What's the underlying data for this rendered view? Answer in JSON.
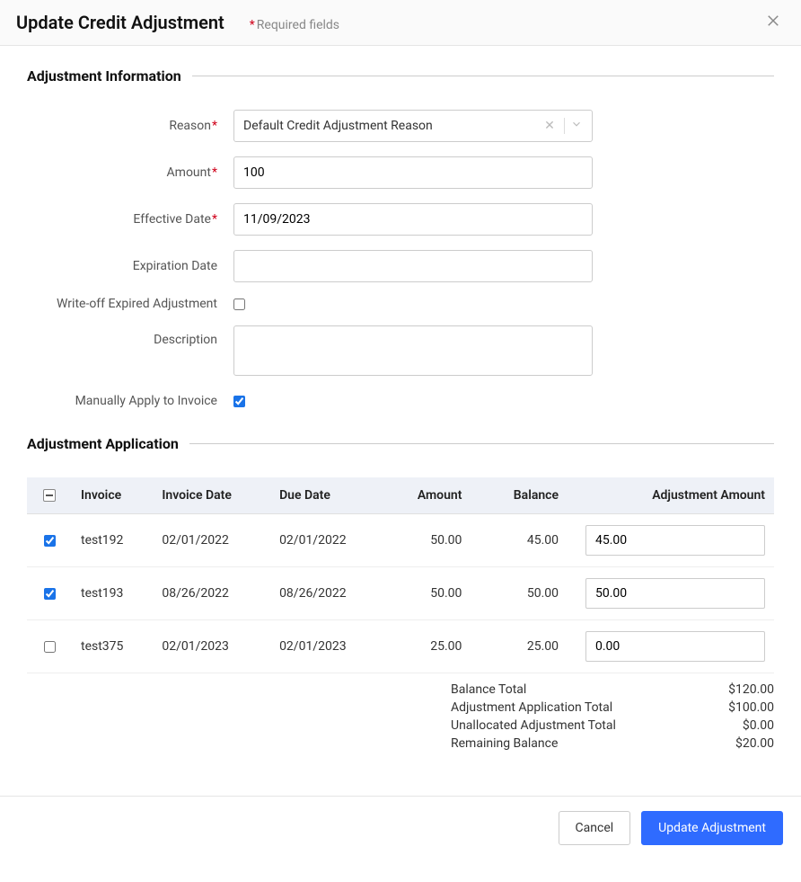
{
  "header": {
    "title": "Update Credit Adjustment",
    "required_note": "Required fields"
  },
  "sections": {
    "adjustment_info_title": "Adjustment Information",
    "adjustment_app_title": "Adjustment Application"
  },
  "form": {
    "labels": {
      "reason": "Reason",
      "amount": "Amount",
      "effective_date": "Effective Date",
      "expiration_date": "Expiration Date",
      "writeoff": "Write-off Expired Adjustment",
      "description": "Description",
      "manual_apply": "Manually Apply to Invoice"
    },
    "values": {
      "reason": "Default Credit Adjustment Reason",
      "amount": "100",
      "effective_date": "11/09/2023",
      "expiration_date": "",
      "writeoff_checked": false,
      "description": "",
      "manual_apply_checked": true
    }
  },
  "table": {
    "headers": {
      "invoice": "Invoice",
      "invoice_date": "Invoice Date",
      "due_date": "Due Date",
      "amount": "Amount",
      "balance": "Balance",
      "adjustment_amount": "Adjustment Amount"
    },
    "rows": [
      {
        "checked": true,
        "invoice": "test192",
        "invoice_date": "02/01/2022",
        "due_date": "02/01/2022",
        "amount": "50.00",
        "balance": "45.00",
        "adjustment": "45.00"
      },
      {
        "checked": true,
        "invoice": "test193",
        "invoice_date": "08/26/2022",
        "due_date": "08/26/2022",
        "amount": "50.00",
        "balance": "50.00",
        "adjustment": "50.00"
      },
      {
        "checked": false,
        "invoice": "test375",
        "invoice_date": "02/01/2023",
        "due_date": "02/01/2023",
        "amount": "25.00",
        "balance": "25.00",
        "adjustment": "0.00"
      }
    ]
  },
  "totals": {
    "balance_total_label": "Balance Total",
    "balance_total_value": "$120.00",
    "adj_app_total_label": "Adjustment Application Total",
    "adj_app_total_value": "$100.00",
    "unallocated_label": "Unallocated Adjustment Total",
    "unallocated_value": "$0.00",
    "remaining_label": "Remaining Balance",
    "remaining_value": "$20.00"
  },
  "footer": {
    "cancel": "Cancel",
    "submit": "Update Adjustment"
  }
}
